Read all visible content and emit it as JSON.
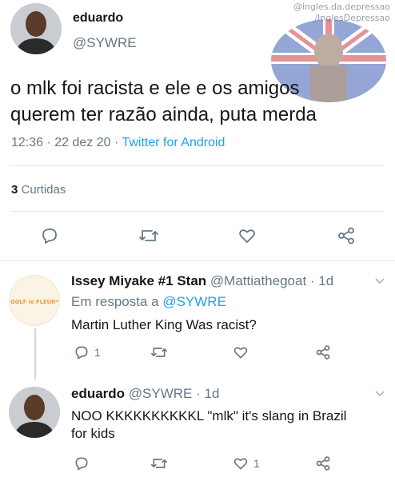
{
  "watermark": {
    "line1": "@ingles.da.depressao",
    "line2": "/InglesDepressao"
  },
  "main": {
    "name": "eduardo",
    "handle": "@SYWRE",
    "text_line1": "o mlk foi racista e ele e os amigos",
    "text_line2": "querem ter razão ainda, puta merda",
    "time": "12:36 · 22 dez 20 · ",
    "source": "Twitter for Android",
    "likes_count": "3",
    "likes_label": " Curtidas"
  },
  "reply1": {
    "name": "Issey Miyake #1 Stan",
    "handle": " @Mattiathegoat · 1d",
    "in_reply_prefix": "Em resposta a ",
    "in_reply_mention": "@SYWRE",
    "text": "Martin Luther King Was racist?",
    "reply_count": "1",
    "avatar_text": "GOLF le FLEUR*"
  },
  "reply2": {
    "name": "eduardo",
    "handle": " @SYWRE · 1d",
    "text_line1": "NOO KKKKKKKKKKL \"mlk\" it's slang in Brazil",
    "text_line2": "for kids",
    "like_count": "1"
  },
  "icons": [
    "reply-icon",
    "retweet-icon",
    "like-icon",
    "share-icon",
    "chevron-down-icon"
  ],
  "colors": {
    "link": "#1da1f2",
    "secondary": "#657786",
    "text": "#14171a",
    "divider": "#e1e8ed"
  }
}
